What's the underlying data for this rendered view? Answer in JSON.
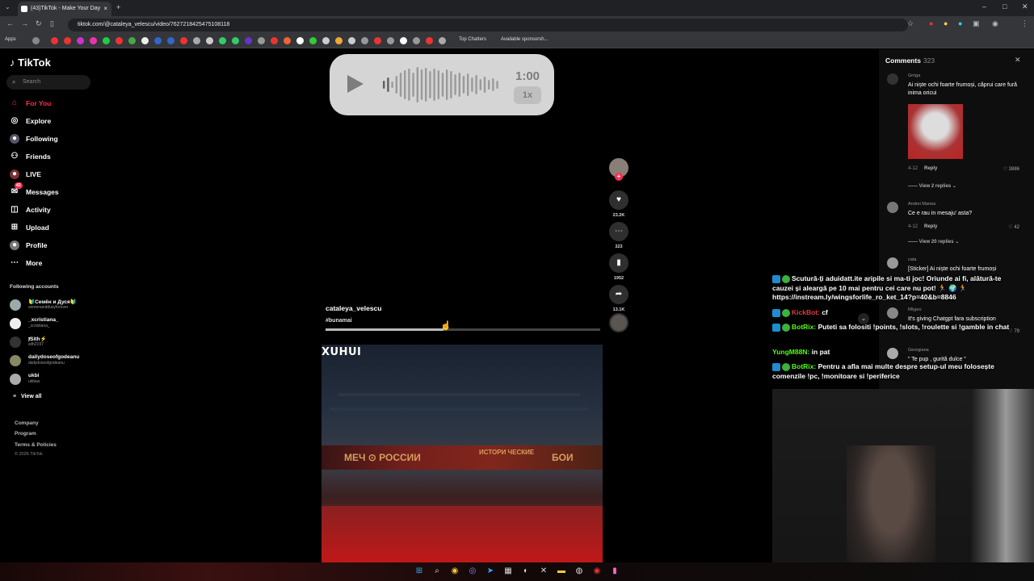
{
  "browser": {
    "tab_title": "(43)TikTok - Make Your Day",
    "tab_close": "×",
    "new_tab": "+",
    "url": "tiktok.com/@cataleya_velescu/video/7627218425475108118",
    "bookmarks": {
      "apps_label": "Apps",
      "top_chatters": "Top Chatters",
      "available_sponsorships": "Available sponsorsh..."
    },
    "window_controls": [
      "–",
      "□",
      "✕"
    ]
  },
  "sidebar": {
    "logo": "TikTok",
    "search_placeholder": "Search",
    "nav": [
      {
        "label": "For You",
        "icon": "home-icon",
        "active": true
      },
      {
        "label": "Explore",
        "icon": "compass-icon"
      },
      {
        "label": "Following",
        "icon": "following-icon"
      },
      {
        "label": "Friends",
        "icon": "friends-icon"
      },
      {
        "label": "LIVE",
        "icon": "live-icon"
      },
      {
        "label": "Messages",
        "icon": "messages-icon",
        "badge": "43"
      },
      {
        "label": "Activity",
        "icon": "activity-icon"
      },
      {
        "label": "Upload",
        "icon": "upload-icon"
      },
      {
        "label": "Profile",
        "icon": "profile-icon"
      },
      {
        "label": "More",
        "icon": "more-icon"
      }
    ],
    "following_heading": "Following accounts",
    "accounts": [
      {
        "name": "🔰Семён и Дуся🔰",
        "handle": "semenanddusyforever"
      },
      {
        "name": "_xcristiana_",
        "handle": "_xcristiana_"
      },
      {
        "name": "ⱦSith⚡",
        "handle": "sith2197"
      },
      {
        "name": "dailydoseofgodeanu",
        "handle": "dailydoseofgodeanu"
      },
      {
        "name": "ukbi",
        "handle": "ukbias"
      }
    ],
    "view_all": "View all",
    "footer": [
      "Company",
      "Program",
      "Terms & Policies",
      "© 2026 TikTok"
    ]
  },
  "audio_player": {
    "time": "1:00",
    "speed": "1x"
  },
  "post": {
    "author": "cataleya_velescu",
    "hashtag": "#bunamai",
    "progress": 0.43
  },
  "actions": {
    "likes": "23.2K",
    "comments": "323",
    "saves": "1952",
    "shares": "13.1K"
  },
  "video": {
    "overlay_text": "XUHUI",
    "banner_text": [
      "МЕЧ ⊙ РОССИИ",
      "ИСТОРИ ЧЕСКИЕ",
      "БОИ"
    ]
  },
  "comments_panel": {
    "title": "Comments",
    "count": "323",
    "reply_label": "Reply",
    "items": [
      {
        "user": "Grriga",
        "text": "Ai niște ochi foarte frumoși, căprui care fură inima oricui",
        "date": "4-12",
        "likes": "3886",
        "replies": "View 2 replies"
      },
      {
        "user": "Andrei Manea",
        "text": "Ce e rau in mesaju' asta?",
        "date": "4-12",
        "likes": "42",
        "replies": "View 20 replies"
      },
      {
        "user": "cata",
        "text": "[Sticker] Ai niște ochi foarte frumoși",
        "date": "",
        "likes": "",
        "replies": ""
      },
      {
        "user": "Rllyjeo",
        "text": "It's giving Chatgpt fara subscription",
        "date": "",
        "likes": "79",
        "replies": ""
      },
      {
        "user": "Georgiana",
        "text": "\" Te pup , gurită dulce \"",
        "date": "",
        "likes": "",
        "replies": ""
      }
    ]
  },
  "stream_chat": {
    "lines": [
      {
        "user": "",
        "text": "Scutură-ți aduidatt.ite aripile si ma-ti joc! Oriunde ai fi, alătură-te cauzei și aleargă pe 10 mai pentru cei care nu pot! 🏃 🌍 🏃 https://instream.ly/wingsforlife_ro_ket_14?p=40&b=8846"
      },
      {
        "user": "KickBot:",
        "text": "cf"
      },
      {
        "user": "BotRix:",
        "text": "Puteti sa folositi !points, !slots, !roulette si !gamble in chat"
      },
      {
        "user": "YungM88N:",
        "text": "in pat"
      },
      {
        "user": "BotRix:",
        "text": "Pentru a afla mai multe despre setup-ul meu folosește comenzile !pc, !monitoare si !periferice"
      }
    ],
    "colors": {
      "kickbot": "#e0393e",
      "botrix": "#53fc18",
      "yung": "#53fc18"
    }
  },
  "colors": {
    "accent": "#fe2c55",
    "panel": "#0e0e0e"
  }
}
